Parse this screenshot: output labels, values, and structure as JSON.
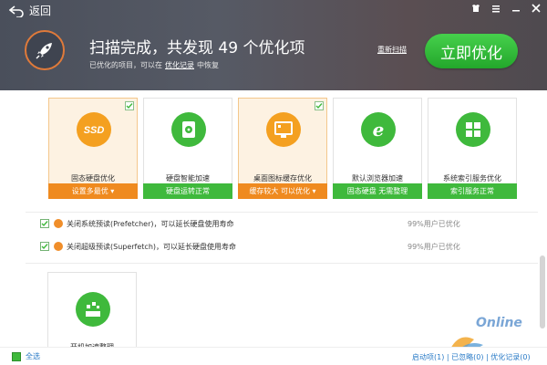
{
  "header": {
    "back_label": "返回",
    "title": "扫描完成，共发现 49 个优化项",
    "sub_prefix": "已优化的项目，可以在",
    "sub_link": "优化记录",
    "sub_suffix": "中恢复",
    "rescan_label": "重新扫描",
    "optimize_label": "立即优化"
  },
  "cards": [
    {
      "label": "固态硬盘优化",
      "bar": "设置多最优",
      "bar_color": "#ef8a1f",
      "selected": true,
      "icon": "ssd-icon"
    },
    {
      "label": "硬盘智能加速",
      "bar": "硬盘运转正常",
      "bar_color": "#3fb93c",
      "selected": false,
      "icon": "disk-icon"
    },
    {
      "label": "桌面图标缓存优化",
      "bar": "缓存较大  可以优化",
      "bar_color": "#ef8a1f",
      "selected": true,
      "icon": "monitor-icon"
    },
    {
      "label": "默认浏览器加速",
      "bar": "固态硬盘  无需整理",
      "bar_color": "#3fb93c",
      "selected": false,
      "icon": "ie-icon"
    },
    {
      "label": "系统索引服务优化",
      "bar": "索引服务正常",
      "bar_color": "#3fb93c",
      "selected": false,
      "icon": "windows-icon"
    }
  ],
  "list": [
    {
      "text": "关闭系统预读(Prefetcher)，可以延长硬盘使用寿命",
      "stat": "99%用户已优化"
    },
    {
      "text": "关闭超级预读(Superfetch)，可以延长硬盘使用寿命",
      "stat": "99%用户已优化"
    }
  ],
  "card2": {
    "label": "开机加速整理"
  },
  "footer": {
    "select_all": "全选",
    "link1": "启动项(1)",
    "link2": "已忽略(0)",
    "link3": "优化记录(0)"
  },
  "watermark": "Online",
  "colors": {
    "accent_orange": "#ef8a1f",
    "accent_green": "#3fb93c",
    "header_bg": "#4f535d"
  }
}
